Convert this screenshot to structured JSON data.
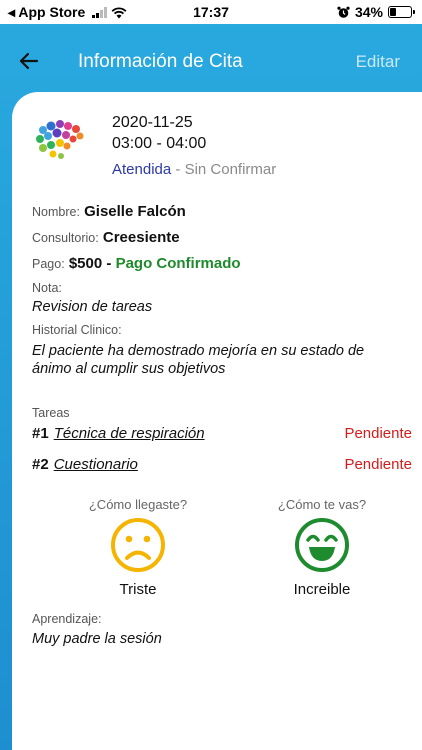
{
  "status_bar": {
    "carrier": "◂ App Store",
    "time": "17:37",
    "battery": "34%",
    "battery_level": 0.34
  },
  "header": {
    "title": "Información de Cita",
    "edit_label": "Editar"
  },
  "appointment": {
    "date": "2020-11-25",
    "time_range": "03:00 - 04:00",
    "status_attended": "Atendida",
    "status_separator": " - ",
    "status_confirm": "Sin Confirmar"
  },
  "details": {
    "name_label": "Nombre:",
    "name_value": "Giselle Falcón",
    "office_label": "Consultorio:",
    "office_value": "Creesiente",
    "payment_label": "Pago:",
    "payment_amount": "$500 -",
    "payment_status": "Pago Confirmado",
    "note_label": "Nota:",
    "note_value": "Revision de tareas",
    "history_label": "Historial Clinico:",
    "history_line1": "El paciente ha demostrado mejoría en su estado de",
    "history_line2": "ánimo al cumplir sus objetivos"
  },
  "tasks": {
    "label": "Tareas",
    "items": [
      {
        "number": "#1",
        "name": "Técnica de respiración",
        "status": "Pendiente"
      },
      {
        "number": "#2",
        "name": "Cuestionario",
        "status": "Pendiente"
      }
    ]
  },
  "feedback": {
    "arrival_question": "¿Cómo llegaste?",
    "arrival_answer": "Triste",
    "arrival_color": "#f5b400",
    "current_question": "¿Cómo te vas?",
    "current_answer": "Increible",
    "current_color": "#1e8c2e"
  },
  "learning": {
    "label": "Aprendizaje:",
    "value": "Muy padre la sesión"
  },
  "colors": {
    "header_gradient_start": "#29aadf",
    "attended": "#2c3aa6",
    "confirmed": "#1f8a2c",
    "pending": "#d41c1c"
  },
  "icons": [
    "back-arrow-icon",
    "wifi-icon",
    "alarm-icon",
    "battery-icon",
    "clinic-logo-icon",
    "sad-face-icon",
    "happy-face-icon"
  ]
}
